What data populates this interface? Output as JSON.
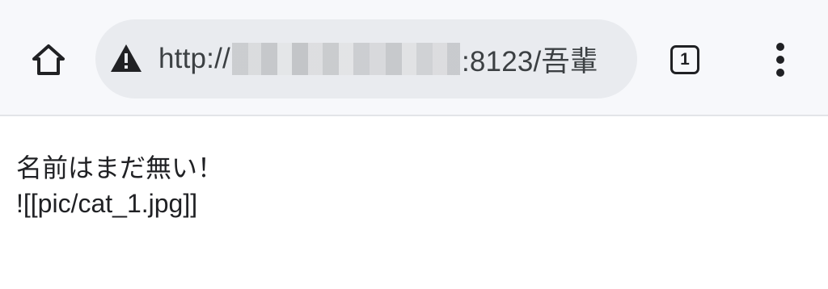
{
  "toolbar": {
    "home_icon": "home-icon",
    "address_bar": {
      "security_icon": "warning-triangle-icon",
      "url_prefix": "http://",
      "url_suffix": ":8123/吾輩"
    },
    "tab_count": "1",
    "menu_icon": "three-dots-vertical-icon"
  },
  "page": {
    "lines": [
      "名前はまだ無い！",
      "![[pic/cat_1.jpg]]"
    ]
  },
  "colors": {
    "toolbar_bg": "#f7f8fb",
    "omnibox_bg": "#e9ebef",
    "icon": "#202124",
    "text": "#202124"
  }
}
